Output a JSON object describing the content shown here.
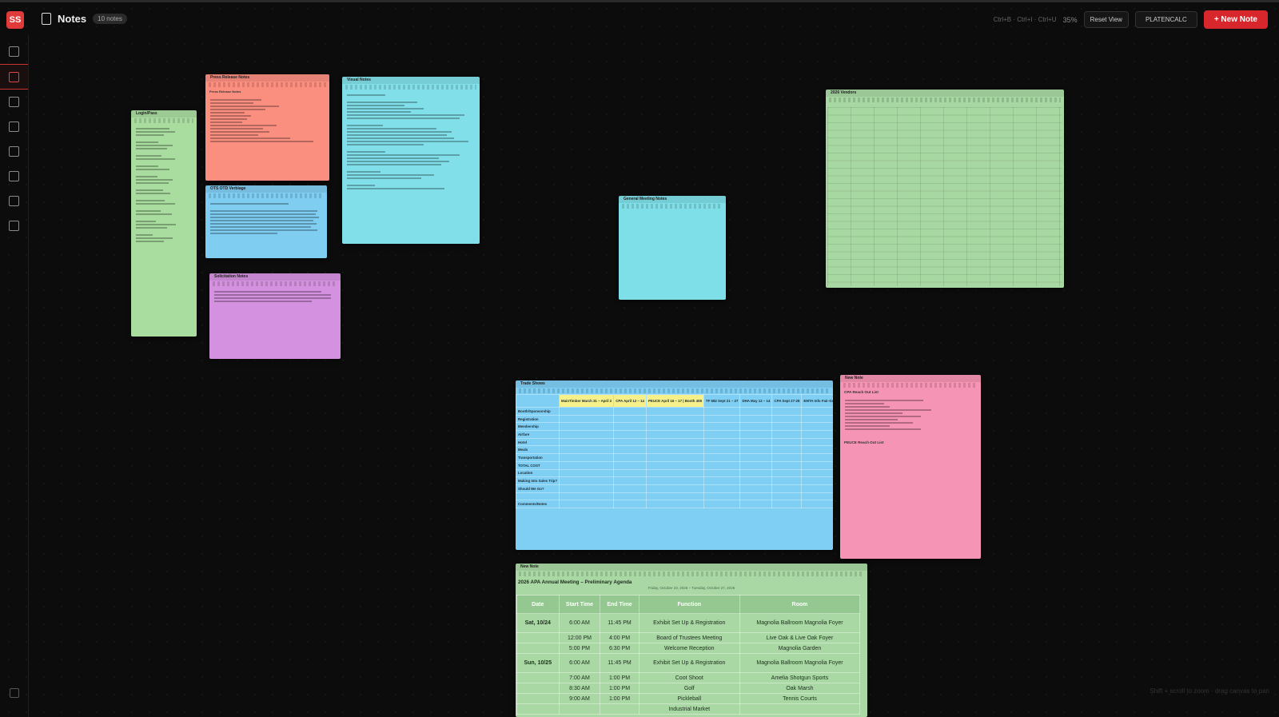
{
  "app": {
    "logo": "SS",
    "title": "Notes",
    "note_count": "10 notes",
    "shortcuts": "Ctrl+B · Ctrl+I · Ctrl+U",
    "zoom": "35%",
    "reset_view": "Reset View",
    "calc_label": "PLATENCALC",
    "new_note": "+ New Note",
    "hint": "Shift + scroll to zoom · drag canvas to pan"
  },
  "sidebar": {
    "items": [
      {
        "icon": "grid-icon"
      },
      {
        "icon": "notes-icon",
        "active": true
      },
      {
        "icon": "chart-icon"
      },
      {
        "icon": "briefcase-icon"
      },
      {
        "icon": "document-icon"
      },
      {
        "icon": "calculator-icon"
      },
      {
        "icon": "card-icon"
      },
      {
        "icon": "database-icon"
      }
    ]
  },
  "notes": {
    "login_pass": {
      "title": "Login/Pass",
      "color": "#a9dda0"
    },
    "press": {
      "title": "Press Release Notes",
      "color": "#fa8f80",
      "heading": "Press Release Notes"
    },
    "visual": {
      "title": "Visual Notes",
      "color": "#80dfe9"
    },
    "ots": {
      "title": "OTS OTD Verbiage",
      "color": "#7fcdf1"
    },
    "solicitation": {
      "title": "Solicitation Notes",
      "color": "#d491df"
    },
    "general": {
      "title": "General Meeting Notes",
      "color": "#7edfe8"
    },
    "vendors": {
      "title": "2026 Vendors",
      "color": "#a8d8a2"
    },
    "tradeshows": {
      "title": "Trade Shows",
      "color": "#7fcff5",
      "columns": [
        "",
        "MainTimber March 31 – April 2",
        "CPA April 12 – 14",
        "PEUCE April 16 – 17 | Booth 408",
        "TF 682 Sept 21 – 27",
        "DHA May 12 – 14",
        "CPA Sept 27-28",
        "EMTA Info Fair-Gold Oct 24 – 27 | Booth 46"
      ],
      "rows": [
        "Booth/Sponsorship",
        "Registration",
        "Membership",
        "Airfare",
        "Hotel",
        "Meals",
        "Transportation",
        "TOTAL COST",
        "Location",
        "Making Into Sales Trip?",
        "Should We Go?",
        "",
        "Comments/Notes"
      ]
    },
    "newnote_pink": {
      "title": "New Note",
      "color": "#f594b4",
      "heading1": "CPA Reach Out List",
      "heading2": "PEUCE Reach Out List"
    },
    "agenda": {
      "title": "New Note",
      "color": "#a9d8a4",
      "heading": "2026 APA Annual Meeting – Preliminary Agenda",
      "dates": "Friday, October 23, 2026 – Tuesday, October 27, 2026",
      "columns": [
        "Date",
        "Start Time",
        "End Time",
        "Function",
        "Room"
      ],
      "rows": [
        {
          "date": "Sat, 10/24",
          "start": "6:00 AM",
          "end": "11:45 PM",
          "function": "Exhibit Set Up & Registration",
          "room": "Magnolia Ballroom Magnolia Foyer"
        },
        {
          "date": "",
          "start": "12:00 PM",
          "end": "4:00 PM",
          "function": "Board of Trustees Meeting",
          "room": "Live Oak & Live Oak Foyer"
        },
        {
          "date": "",
          "start": "5:00 PM",
          "end": "6:30 PM",
          "function": "Welcome Reception",
          "room": "Magnolia Garden"
        },
        {
          "date": "Sun, 10/25",
          "start": "6:00 AM",
          "end": "11:45 PM",
          "function": "Exhibit Set Up & Registration",
          "room": "Magnolia Ballroom Magnolia Foyer"
        },
        {
          "date": "",
          "start": "7:00 AM",
          "end": "1:00 PM",
          "function": "Coot Shoot",
          "room": "Amelia Shotgun Sports"
        },
        {
          "date": "",
          "start": "8:30 AM",
          "end": "1:00 PM",
          "function": "Golf",
          "room": "Oak Marsh"
        },
        {
          "date": "",
          "start": "9:00 AM",
          "end": "1:00 PM",
          "function": "Pickleball",
          "room": "Tennis Courts"
        },
        {
          "date": "",
          "start": "",
          "end": "",
          "function": "Industrial Market",
          "room": ""
        }
      ]
    }
  }
}
